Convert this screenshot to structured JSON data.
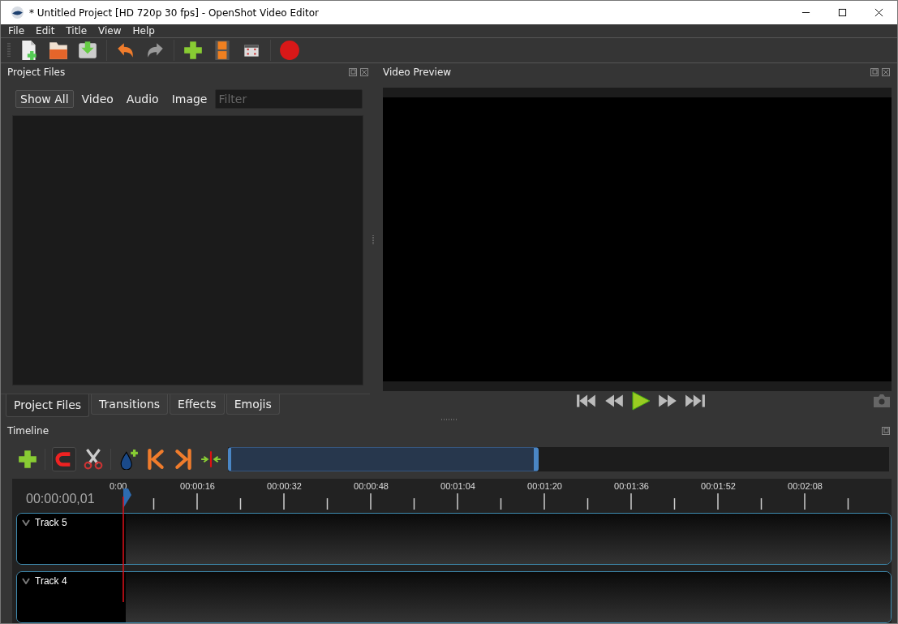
{
  "window": {
    "title": "* Untitled Project [HD 720p 30 fps] - OpenShot Video Editor"
  },
  "menu": [
    {
      "label": "File"
    },
    {
      "label": "Edit"
    },
    {
      "label": "Title"
    },
    {
      "label": "View"
    },
    {
      "label": "Help"
    }
  ],
  "project_files": {
    "title": "Project Files",
    "filters": [
      {
        "label": "Show All",
        "selected": true
      },
      {
        "label": "Video",
        "selected": false
      },
      {
        "label": "Audio",
        "selected": false
      },
      {
        "label": "Image",
        "selected": false
      }
    ],
    "filter_field": {
      "placeholder": "Filter"
    }
  },
  "video_preview": {
    "title": "Video Preview"
  },
  "bottom_tabs": [
    {
      "label": "Project Files",
      "selected": true
    },
    {
      "label": "Transitions",
      "selected": false
    },
    {
      "label": "Effects",
      "selected": false
    },
    {
      "label": "Emojis",
      "selected": false
    }
  ],
  "timeline": {
    "title": "Timeline",
    "snapping": {
      "on": true
    },
    "zoom_range": {
      "level": 0.47
    },
    "timecode": "00:00:00,01",
    "ruler": [
      "0:00",
      "00:00:16",
      "00:00:32",
      "00:00:48",
      "00:01:04",
      "00:01:20",
      "00:01:36",
      "00:01:52",
      "00:02:08"
    ],
    "tracks": [
      {
        "name": "Track 5"
      },
      {
        "name": "Track 4"
      }
    ]
  }
}
